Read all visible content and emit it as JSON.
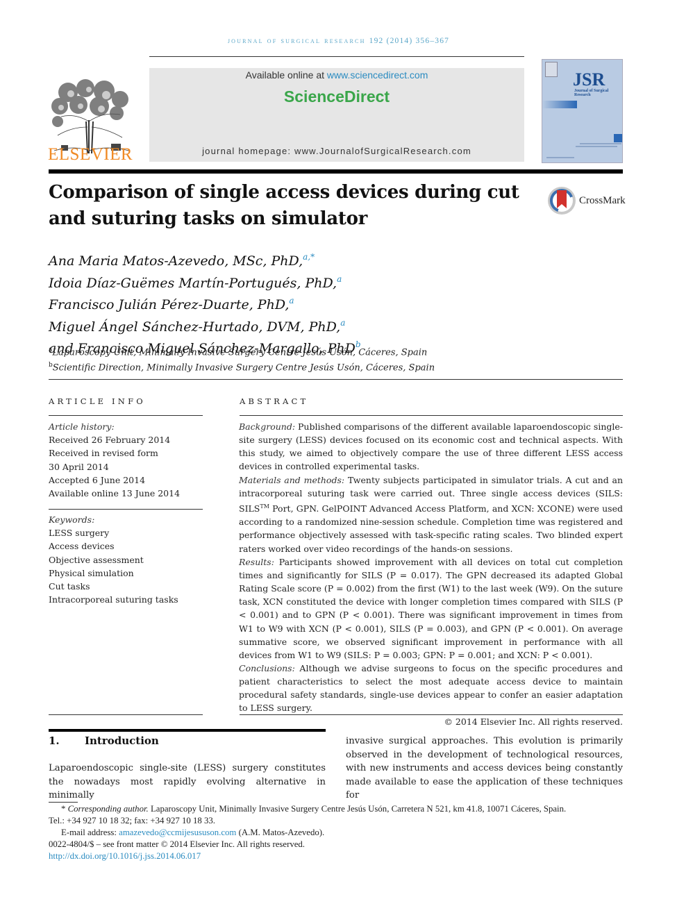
{
  "running_header": {
    "journal": "JOURNAL OF SURGICAL RESEARCH",
    "citation": "192 (2014) 356–367"
  },
  "publisher": {
    "name": "ELSEVIER",
    "brand_color": "#f08a24"
  },
  "banner": {
    "available_prefix": "Available online at",
    "available_link": "www.sciencedirect.com",
    "logo_text": "ScienceDirect",
    "logo_color": "#3aa64a",
    "homepage": "journal homepage: www.JournalofSurgicalResearch.com"
  },
  "journal_cover": {
    "abbrev": "JSR",
    "subtitle": "Journal of Surgical Research"
  },
  "crossmark": {
    "label": "CrossMark"
  },
  "article": {
    "title": "Comparison of single access devices during cut and suturing tasks on simulator"
  },
  "authors": [
    {
      "name": "Ana Maria Matos-Azevedo, MSc, PhD,",
      "sup": "a,*"
    },
    {
      "name": "Idoia Díaz-Guëmes Martín-Portugués, PhD,",
      "sup": "a"
    },
    {
      "name": "Francisco Julián Pérez-Duarte, PhD,",
      "sup": "a"
    },
    {
      "name": "Miguel Ángel Sánchez-Hurtado, DVM, PhD,",
      "sup": "a"
    },
    {
      "name": "and Francisco Miguel Sánchez-Margallo, PhD",
      "sup": "b"
    }
  ],
  "affiliations": [
    {
      "sup": "a",
      "text": "Laparoscopy Unit, Minimally Invasive Surgery Centre Jesús Usón, Cáceres, Spain"
    },
    {
      "sup": "b",
      "text": "Scientific Direction, Minimally Invasive Surgery Centre Jesús Usón, Cáceres, Spain"
    }
  ],
  "article_info": {
    "heading": "ARTICLE INFO",
    "history_label": "Article history:",
    "history": [
      "Received 26 February 2014",
      "Received in revised form",
      "30 April 2014",
      "Accepted 6 June 2014",
      "Available online 13 June 2014"
    ],
    "keywords_label": "Keywords:",
    "keywords": [
      "LESS surgery",
      "Access devices",
      "Objective assessment",
      "Physical simulation",
      "Cut tasks",
      "Intracorporeal suturing tasks"
    ]
  },
  "abstract": {
    "heading": "ABSTRACT",
    "sections": [
      {
        "label": "Background:",
        "text": "Published comparisons of the different available laparoendoscopic single-site surgery (LESS) devices focused on its economic cost and technical aspects. With this study, we aimed to objectively compare the use of three different LESS access devices in controlled experimental tasks."
      },
      {
        "label": "Materials and methods:",
        "text_pre": "Twenty subjects participated in simulator trials. A cut and an intracorporeal suturing task were carried out. Three single access devices (SILS: SILS",
        "tm": "TM",
        "text_post": " Port, GPN. GelPOINT Advanced Access Platform, and XCN: XCONE) were used according to a randomized nine-session schedule. Completion time was registered and performance objectively assessed with task-specific rating scales. Two blinded expert raters worked over video recordings of the hands-on sessions."
      },
      {
        "label": "Results:",
        "text": "Participants showed improvement with all devices on total cut completion times and significantly for SILS (P = 0.017). The GPN decreased its adapted Global Rating Scale score (P = 0.002) from the first (W1) to the last week (W9). On the suture task, XCN constituted the device with longer completion times compared with SILS (P < 0.001) and to GPN (P < 0.001). There was significant improvement in times from W1 to W9 with XCN (P < 0.001), SILS (P = 0.003), and GPN (P < 0.001). On average summative score, we observed significant improvement in performance with all devices from W1 to W9 (SILS: P = 0.003; GPN: P = 0.001; and XCN: P < 0.001)."
      },
      {
        "label": "Conclusions:",
        "text": "Although we advise surgeons to focus on the specific procedures and patient characteristics to select the most adequate access device to maintain procedural safety standards, single-use devices appear to confer an easier adaptation to LESS surgery."
      }
    ],
    "copyright": "© 2014 Elsevier Inc. All rights reserved."
  },
  "introduction": {
    "number": "1.",
    "heading": "Introduction",
    "left_text": "Laparoendoscopic single-site (LESS) surgery constitutes the nowadays most rapidly evolving alternative in minimally",
    "right_text": "invasive surgical approaches. This evolution is primarily observed in the development of technological resources, with new instruments and access devices being constantly made available to ease the application of these techniques for"
  },
  "footnotes": {
    "corresponding_marker": "*",
    "corresponding_label": "Corresponding author.",
    "corresponding_text": "Laparoscopy Unit, Minimally Invasive Surgery Centre Jesús Usón, Carretera N 521, km 41.8, 10071 Cáceres, Spain.",
    "phone": "Tel.: +34 927 10 18 32; fax: +34 927 10 18 33.",
    "email_label": "E-mail address:",
    "email": "amazevedo@ccmijesususon.com",
    "email_owner": "(A.M. Matos-Azevedo).",
    "front_matter": "0022-4804/$ – see front matter © 2014 Elsevier Inc. All rights reserved.",
    "doi": "http://dx.doi.org/10.1016/j.jss.2014.06.017"
  },
  "colors": {
    "link": "#2a8bc0",
    "header_text": "#5aa6c8"
  }
}
